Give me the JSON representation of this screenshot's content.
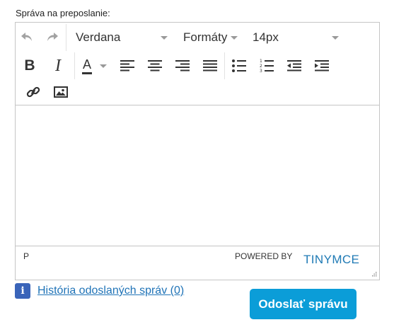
{
  "label": "Správa na preposlanie:",
  "toolbar": {
    "undo_icon": "undo-icon",
    "redo_icon": "redo-icon",
    "font_family": "Verdana",
    "formats": "Formáty",
    "font_size": "14px",
    "bold": "B",
    "italic": "I",
    "text_color": "A",
    "icons": [
      "align-left-icon",
      "align-center-icon",
      "align-right-icon",
      "align-justify-icon",
      "bullet-list-icon",
      "numbered-list-icon",
      "outdent-icon",
      "indent-icon",
      "link-icon",
      "image-icon"
    ]
  },
  "statusbar": {
    "path": "P",
    "powered_by": "POWERED BY",
    "brand": "TINYMCE"
  },
  "history_link": "História odoslaných správ (0)",
  "send_button": "Odoslať správu",
  "colors": {
    "send_button": "#0b9dd8",
    "link": "#1f73b7",
    "brand": "#1f7ab5",
    "info_icon": "#3a64b9"
  }
}
